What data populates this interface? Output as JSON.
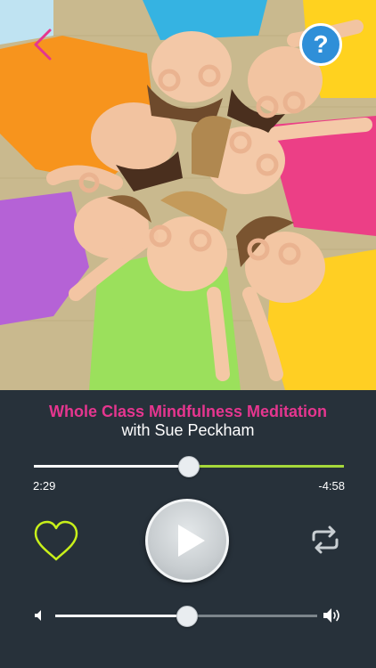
{
  "track": {
    "title": "Whole Class Mindfulness Meditation",
    "subtitle": "with Sue Peckham"
  },
  "playback": {
    "elapsed": "2:29",
    "remaining": "-4:58",
    "progress_fraction": 0.498
  },
  "volume": {
    "level_fraction": 0.5
  },
  "controls": {
    "help_label": "?"
  },
  "icons": {
    "back": "chevron-left-icon",
    "help": "question-mark-icon",
    "favorite": "heart-icon",
    "play": "play-icon",
    "repeat": "repeat-icon",
    "volume_low": "speaker-low-icon",
    "volume_high": "speaker-high-icon"
  },
  "colors": {
    "accent_pink": "#e5368f",
    "accent_green": "#a6d83a",
    "help_blue": "#2f8fd8",
    "background": "#27313a"
  }
}
